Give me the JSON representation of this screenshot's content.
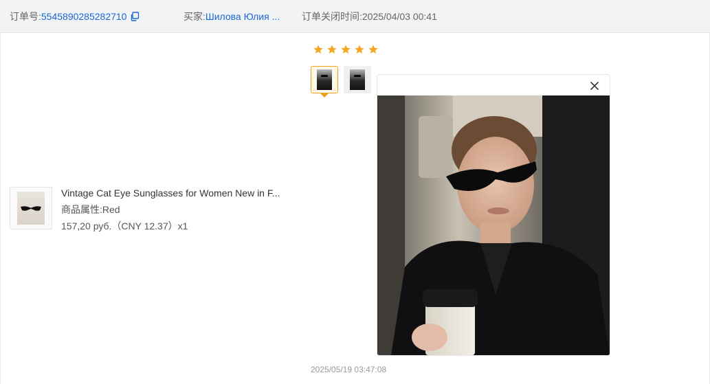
{
  "header": {
    "order_label": "订单号:",
    "order_number": "5545890285282710",
    "buyer_label": "买家:",
    "buyer_name": "Шилова Юлия ...",
    "close_time_label": "订单关闭时间:",
    "close_time": "2025/04/03 00:41",
    "copy_icon": "copy-icon",
    "link_color": "#1a66d9"
  },
  "product": {
    "title": "Vintage Cat Eye Sunglasses for Women New in F...",
    "attribute_label": "商品属性:",
    "attribute_value": "Red",
    "price": "157,20 руб.（CNY  12.37）x1"
  },
  "review": {
    "rating": 5,
    "rating_max": 5,
    "star_color": "#f5a623",
    "thumbnails": [
      {
        "active": true
      },
      {
        "active": false
      }
    ],
    "timestamp": "2025/05/19 03:47:08"
  },
  "preview": {
    "close_icon": "close-icon"
  }
}
